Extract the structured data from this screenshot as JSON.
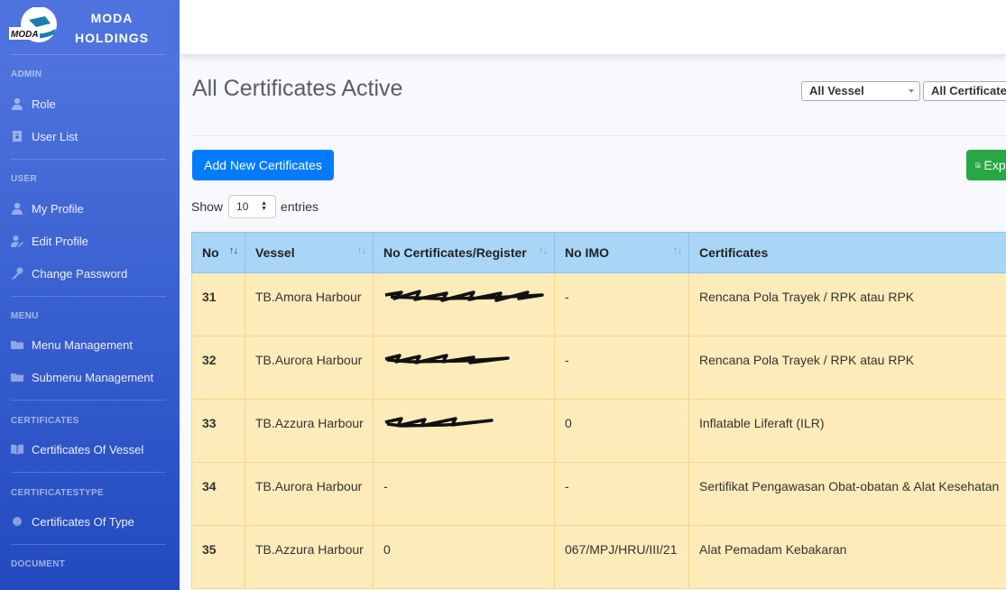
{
  "brand": {
    "logo_text": "MODA",
    "name_line1": "MODA",
    "name_line2": "HOLDINGS"
  },
  "sidebar": {
    "sections": [
      {
        "heading": "ADMIN",
        "items": [
          {
            "label": "Role",
            "icon": "user-icon"
          },
          {
            "label": "User List",
            "icon": "id-badge-icon"
          }
        ]
      },
      {
        "heading": "USER",
        "items": [
          {
            "label": "My Profile",
            "icon": "user-icon"
          },
          {
            "label": "Edit Profile",
            "icon": "user-edit-icon"
          },
          {
            "label": "Change Password",
            "icon": "key-icon"
          }
        ]
      },
      {
        "heading": "MENU",
        "items": [
          {
            "label": "Menu Management",
            "icon": "folder-icon"
          },
          {
            "label": "Submenu Management",
            "icon": "folder-icon"
          }
        ]
      },
      {
        "heading": "CERTIFICATES",
        "items": [
          {
            "label": "Certificates Of Vessel",
            "icon": "book-icon"
          }
        ]
      },
      {
        "heading": "CERTIFICATESTYPE",
        "items": [
          {
            "label": "Certificates Of Type",
            "icon": "circle-icon"
          }
        ]
      },
      {
        "heading": "DOCUMENT",
        "items": []
      }
    ]
  },
  "page": {
    "title": "All Certificates Active"
  },
  "filters": {
    "vessel": "All Vessel",
    "certificate": "All Certificates"
  },
  "actions": {
    "add_label": "Add New Certificates",
    "export_label": "Export"
  },
  "length_menu": {
    "show": "Show",
    "value": "10",
    "entries": "entries"
  },
  "table": {
    "headers": [
      "No",
      "Vessel",
      "No Certificates/Register",
      "No IMO",
      "Certificates"
    ],
    "rows": [
      {
        "no": "31",
        "vessel": "TB.Amora Harbour",
        "register": "",
        "imo": "-",
        "certificate": "Rencana Pola Trayek / RPK atau RPK",
        "register_redacted": true
      },
      {
        "no": "32",
        "vessel": "TB.Aurora Harbour",
        "register": "",
        "imo": "-",
        "certificate": "Rencana Pola Trayek / RPK atau RPK",
        "register_redacted": true
      },
      {
        "no": "33",
        "vessel": "TB.Azzura Harbour",
        "register": "",
        "imo": "0",
        "certificate": "Inflatable Liferaft (ILR)",
        "register_redacted": true
      },
      {
        "no": "34",
        "vessel": "TB.Aurora Harbour",
        "register": "-",
        "imo": "-",
        "certificate": "Sertifikat Pengawasan Obat-obatan & Alat Kesehatan",
        "register_redacted": false
      },
      {
        "no": "35",
        "vessel": "TB.Azzura Harbour",
        "register": "0",
        "imo": "067/MPJ/HRU/III/21",
        "certificate": "Alat Pemadam Kebakaran",
        "register_redacted": false
      }
    ]
  },
  "colors": {
    "sidebar_top": "#4e73df",
    "sidebar_bottom": "#224abe",
    "primary": "#007bff",
    "success": "#28a745",
    "table_header": "#a9d6f7",
    "table_row": "#fdebb9"
  }
}
